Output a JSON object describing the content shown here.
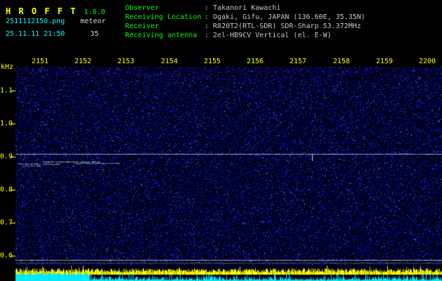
{
  "app": {
    "title": "H R O F F T",
    "version": "1.0.0",
    "filename": "2511112150.png",
    "mode": "meteor",
    "datetime": "25.11.11 21:50",
    "count": "35"
  },
  "station": {
    "separator": ":",
    "fields": [
      {
        "label": "Observer",
        "value": "Takanori Kawachi"
      },
      {
        "label": "Receiving Location",
        "value": "Ogaki, Gifu, JAPAN (136.60E, 35.35N)"
      },
      {
        "label": "Receiver",
        "value": "R820T2(RTL-SDR) SDR-Sharp 53.372MHz"
      },
      {
        "label": "Receiving antenna",
        "value": "2el-HB9CV Vertical (el. E-W)"
      }
    ]
  },
  "spectrogram": {
    "freq_unit": "kHz",
    "time_labels": [
      "2151",
      "2152",
      "2153",
      "2154",
      "2155",
      "2156",
      "2157",
      "2158",
      "2159",
      "2200"
    ],
    "freq_labels": [
      "1.1",
      "1.0",
      "0.9",
      "0.8",
      "0.7",
      "0.6"
    ],
    "carrier_line_khz": 0.91
  },
  "colors": {
    "title_yellow": "#ffff00",
    "version_green": "#00ff00",
    "cyan_text": "#00ffff",
    "white_text": "#c8c8c8",
    "label_green": "#00ff00",
    "axis_yellow": "#ffff00",
    "noise_base": "#000014",
    "carrier_line": "#9adcff",
    "bottom_yellow": "#ffff00",
    "bottom_cyan": "#00eaff"
  }
}
